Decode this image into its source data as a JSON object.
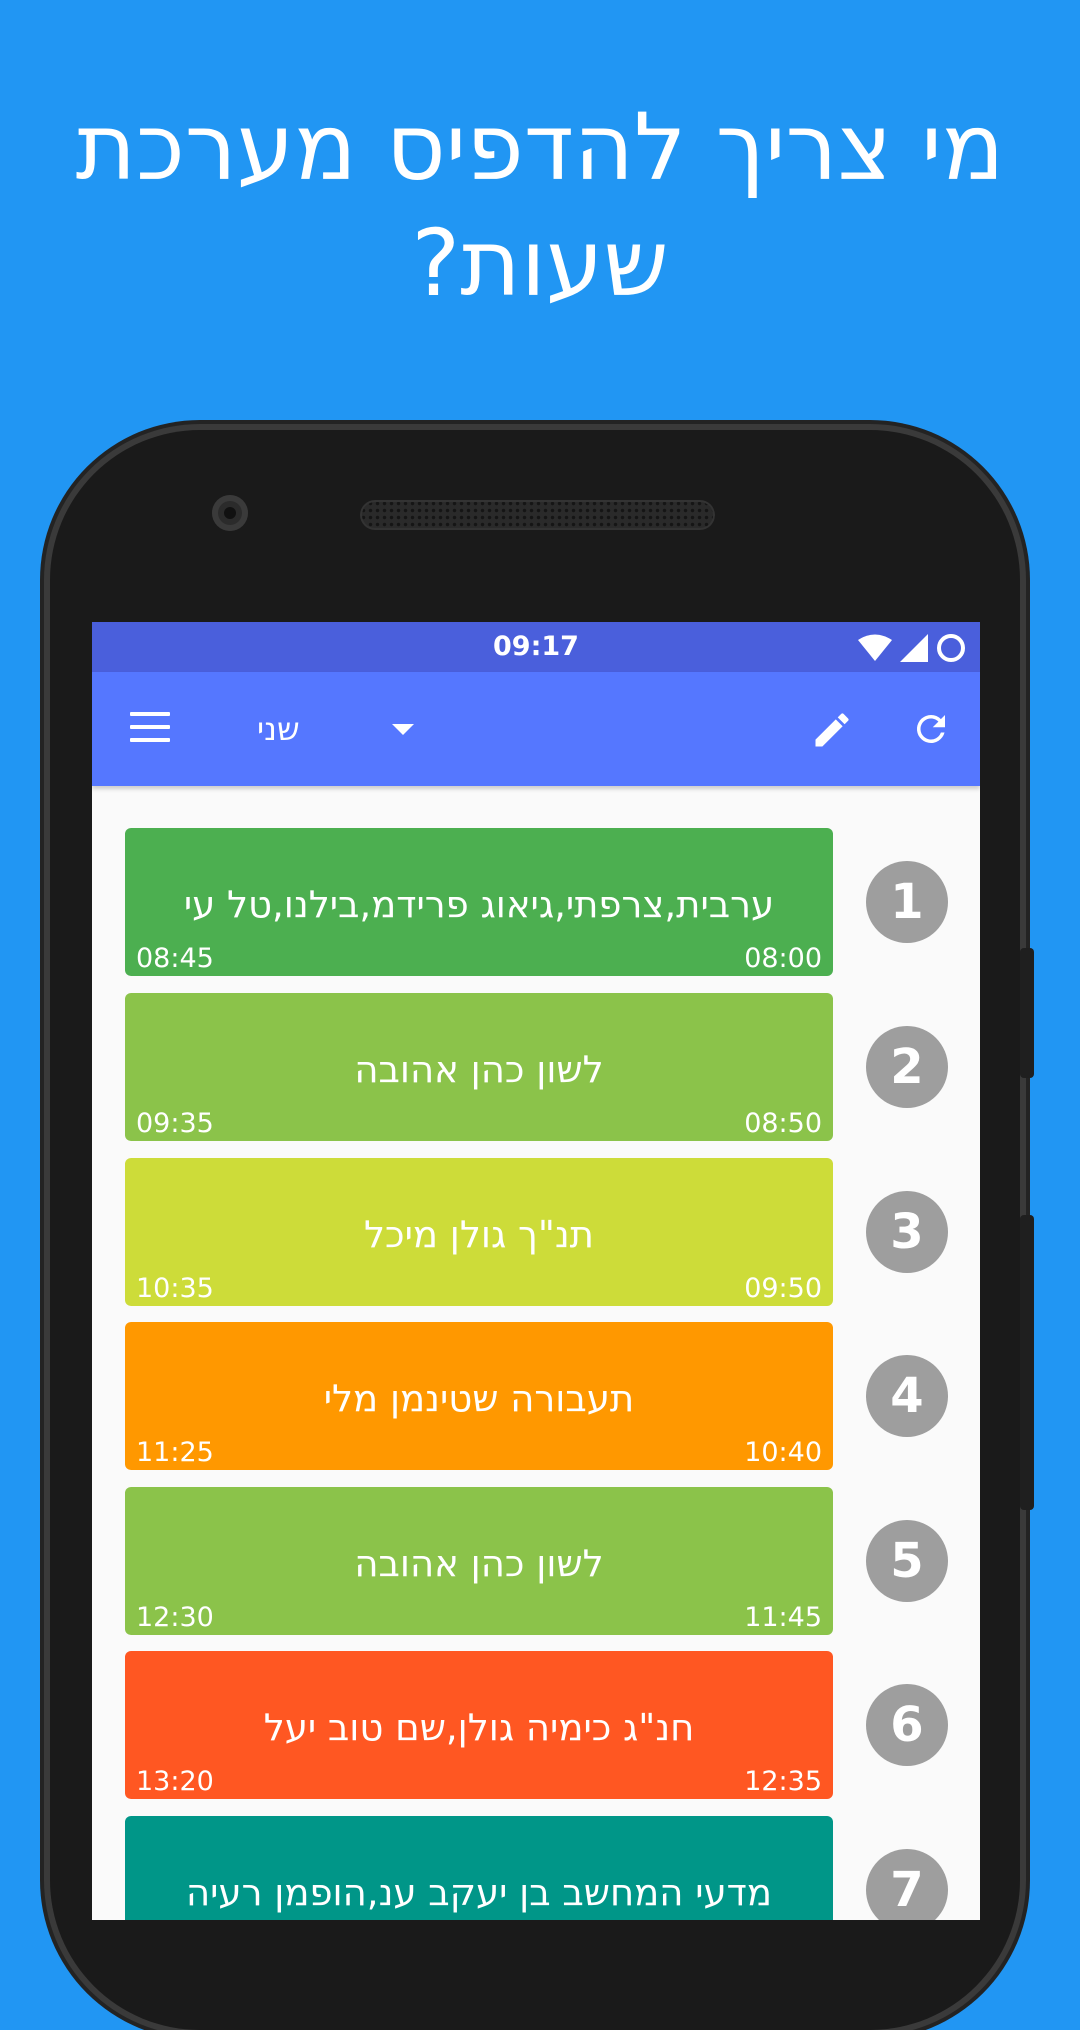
{
  "headline": {
    "line1": "מי צריך להדפיס מערכת",
    "line2": "שעות?"
  },
  "status_bar": {
    "time": "09:17"
  },
  "app_bar": {
    "day": "שני"
  },
  "lessons": [
    {
      "period": "1",
      "subject": "ערבית,צרפתי,גיאוג פרידמ,בילנו,טל עי",
      "start": "08:00",
      "end": "08:45",
      "color": "#4CAF50"
    },
    {
      "period": "2",
      "subject": "לשון כהן אהובה",
      "start": "08:50",
      "end": "09:35",
      "color": "#8BC34A"
    },
    {
      "period": "3",
      "subject": "תנ\"ך גולן מיכל",
      "start": "09:50",
      "end": "10:35",
      "color": "#CDDC39"
    },
    {
      "period": "4",
      "subject": "תעבורה שטינמן מלי",
      "start": "10:40",
      "end": "11:25",
      "color": "#FF9800"
    },
    {
      "period": "5",
      "subject": "לשון כהן אהובה",
      "start": "11:45",
      "end": "12:30",
      "color": "#8BC34A"
    },
    {
      "period": "6",
      "subject": "חנ\"ג כימיה גולן,שם טוב יעל",
      "start": "12:35",
      "end": "13:20",
      "color": "#FF5722"
    },
    {
      "period": "7",
      "subject": "מדעי המחשב בן יעקב ענ,הופמן רעיה",
      "start": "",
      "end": "",
      "color": "#009688"
    }
  ]
}
